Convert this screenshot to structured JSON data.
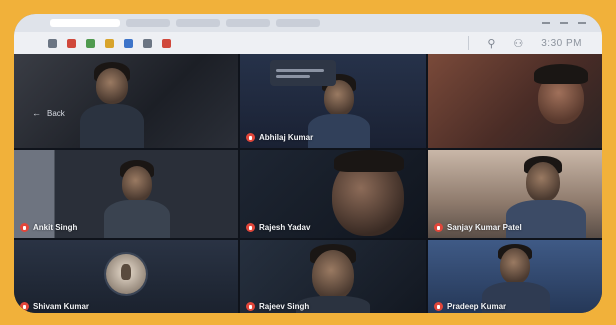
{
  "browser": {
    "tabs": [
      "",
      "",
      "",
      "",
      "",
      ""
    ],
    "clock": "3:30 PM"
  },
  "call": {
    "back_label": "Back",
    "participants": [
      {
        "name": ""
      },
      {
        "name": "Abhilaj Kumar"
      },
      {
        "name": ""
      },
      {
        "name": "Ankit Singh"
      },
      {
        "name": "Rajesh Yadav"
      },
      {
        "name": "Sanjay Kumar Patel"
      },
      {
        "name": "Shivam Kumar"
      },
      {
        "name": "Rajeev Singh"
      },
      {
        "name": "Pradeep Kumar"
      }
    ]
  },
  "colors": {
    "frame": "#f1b13a",
    "mic_muted": "#e2463a",
    "tile_bg": "#1d2330"
  }
}
